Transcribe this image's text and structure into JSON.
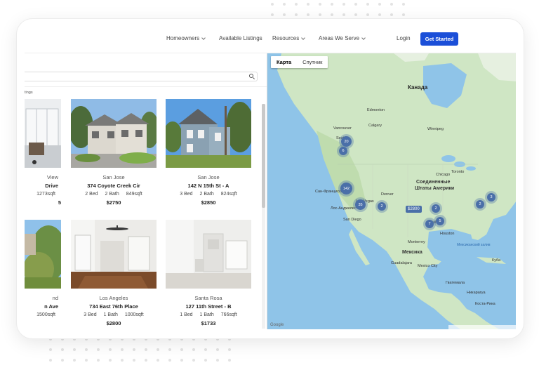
{
  "header": {
    "nav": [
      {
        "label": "Homeowners",
        "dropdown": true
      },
      {
        "label": "Available Listings",
        "dropdown": false
      },
      {
        "label": "Resources",
        "dropdown": true
      },
      {
        "label": "Areas We Serve",
        "dropdown": true
      }
    ],
    "login_label": "Login",
    "cta_label": "Get Started",
    "cta_color": "#1b4fd8"
  },
  "left": {
    "sublabel": "tings",
    "listings": [
      {
        "city": "View",
        "address": "Drive",
        "beds": "",
        "baths": "",
        "sqft": "1273sqft",
        "price": "5"
      },
      {
        "city": "San Jose",
        "address": "374 Coyote Creek Cir",
        "beds": "2 Bed",
        "baths": "2 Bath",
        "sqft": "849sqft",
        "price": "$2750"
      },
      {
        "city": "San Jose",
        "address": "142 N 15th St - A",
        "beds": "3 Bed",
        "baths": "2 Bath",
        "sqft": "824sqft",
        "price": "$2850"
      },
      {
        "city": "nd",
        "address": "n Ave",
        "beds": "",
        "baths": "",
        "sqft": "1500sqft",
        "price": ""
      },
      {
        "city": "Los Angeles",
        "address": "734 East 76th Place",
        "beds": "3 Bed",
        "baths": "1 Bath",
        "sqft": "1000sqft",
        "price": "$2800"
      },
      {
        "city": "Santa Rosa",
        "address": "127 11th Street - B",
        "beds": "1 Bed",
        "baths": "1 Bath",
        "sqft": "766sqft",
        "price": "$1733"
      }
    ]
  },
  "map": {
    "tabs": [
      {
        "label": "Карта",
        "active": true
      },
      {
        "label": "Спутник",
        "active": false
      }
    ],
    "labels": {
      "canada": "Канада",
      "usa_1": "Соединенные",
      "usa_2": "Штаты Америки",
      "mexico": "Мексика",
      "edmonton": "Edmonton",
      "calgary": "Calgary",
      "vancouver": "Vancouver",
      "seattle": "Seattle",
      "winnipeg": "Winnipeg",
      "san_francisco": "Сан-Франциско",
      "los_angeles": "Лос-Анджелес",
      "san_diego": "San Diego",
      "las_vegas": "Las Vegas",
      "denver": "Denver",
      "chicago": "Chicago",
      "toronto": "Toronto",
      "dallas": "Dallas",
      "houston": "Houston",
      "monterrey": "Monterrey",
      "mexico_city": "Mexico City",
      "guadalajara": "Guadalajara",
      "guatemala": "Гватемала",
      "nicaragua": "Никарагуа",
      "costa_rica": "Коста-Рика",
      "gulf": "Мексиканский залив",
      "cuba": "Куба",
      "google": "Google"
    },
    "clusters": [
      "20",
      "6",
      "142",
      "35",
      "2",
      "7",
      "5",
      "2",
      "3",
      "2"
    ],
    "price_tag": "$2800",
    "water_color": "#8fc4e8",
    "land_color": "#cfe6c4"
  }
}
